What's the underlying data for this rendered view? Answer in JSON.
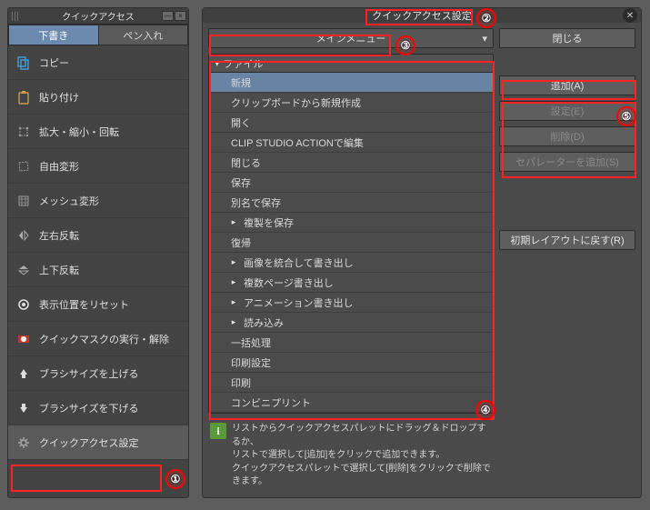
{
  "palette": {
    "title": "クイックアクセス",
    "tabs": [
      "下書き",
      "ペン入れ"
    ],
    "activeTab": 0,
    "items": [
      {
        "label": "コピー",
        "icon": "copy"
      },
      {
        "label": "貼り付け",
        "icon": "paste"
      },
      {
        "label": "拡大・縮小・回転",
        "icon": "scale"
      },
      {
        "label": "自由変形",
        "icon": "freeform"
      },
      {
        "label": "メッシュ変形",
        "icon": "mesh"
      },
      {
        "label": "左右反転",
        "icon": "fliph"
      },
      {
        "label": "上下反転",
        "icon": "flipv"
      },
      {
        "label": "表示位置をリセット",
        "icon": "reset"
      },
      {
        "label": "クイックマスクの実行・解除",
        "icon": "mask"
      },
      {
        "label": "ブラシサイズを上げる",
        "icon": "brushup"
      },
      {
        "label": "ブラシサイズを下げる",
        "icon": "brushdown"
      },
      {
        "label": "クイックアクセス設定",
        "icon": "gear"
      }
    ],
    "selected": 11
  },
  "dialog": {
    "title": "クイックアクセス設定",
    "dropdown": "メインメニュー",
    "close": "閉じる",
    "buttons": {
      "add": "追加(A)",
      "settings": "設定(E)",
      "delete": "削除(D)",
      "sep": "セパレーターを追加(S)",
      "restore": "初期レイアウトに戻す(R)"
    },
    "treeHead": "ファイル",
    "tree": [
      {
        "label": "新規",
        "sel": true
      },
      {
        "label": "クリップボードから新規作成"
      },
      {
        "label": "開く"
      },
      {
        "label": "CLIP STUDIO ACTIONで編集"
      },
      {
        "label": "閉じる"
      },
      {
        "label": "保存"
      },
      {
        "label": "別名で保存"
      },
      {
        "label": "複製を保存",
        "sub": true
      },
      {
        "label": "復帰"
      },
      {
        "label": "画像を統合して書き出し",
        "sub": true
      },
      {
        "label": "複数ページ書き出し",
        "sub": true
      },
      {
        "label": "アニメーション書き出し",
        "sub": true
      },
      {
        "label": "読み込み",
        "sub": true
      },
      {
        "label": "一括処理"
      },
      {
        "label": "印刷設定"
      },
      {
        "label": "印刷"
      },
      {
        "label": "コンビニプリント"
      }
    ],
    "hint": "リストからクイックアクセスパレットにドラッグ＆ドロップするか、\nリストで選択して[追加]をクリックで追加できます。\nクイックアクセスパレットで選択して[削除]をクリックで削除できます。"
  },
  "callouts": {
    "c1": "①",
    "c2": "②",
    "c3": "③",
    "c4": "④",
    "c5": "⑤"
  }
}
